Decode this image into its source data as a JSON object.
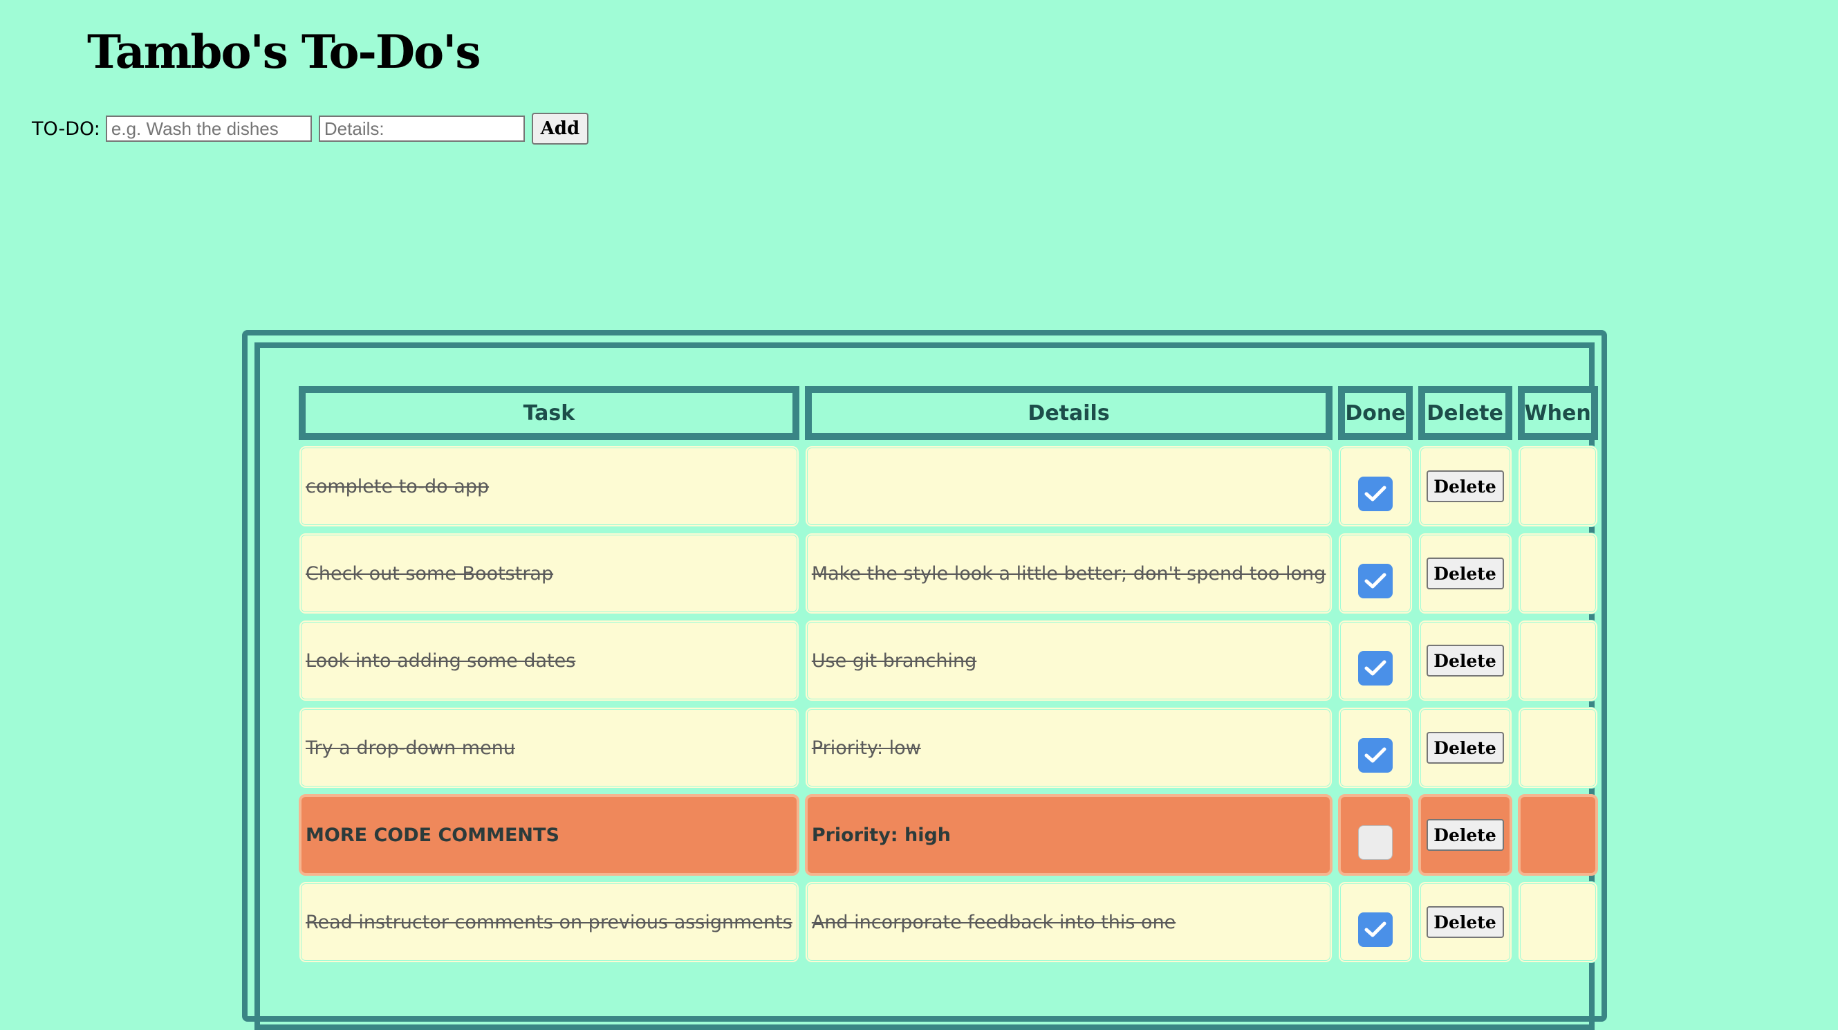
{
  "app": {
    "title": "Tambo's To-Do's"
  },
  "form": {
    "label": "TO-DO:",
    "task_placeholder": "e.g. Wash the dishes",
    "details_placeholder": "Details:",
    "add_label": "Add"
  },
  "table": {
    "headers": {
      "task": "Task",
      "details": "Details",
      "done": "Done",
      "delete": "Delete",
      "when": "When"
    },
    "rows": [
      {
        "task": "complete to-do app",
        "details": "",
        "done": true,
        "delete_label": "Delete",
        "when": ""
      },
      {
        "task": "Check out some Bootstrap",
        "details": "Make the style look a little better; don't spend too long",
        "done": true,
        "delete_label": "Delete",
        "when": ""
      },
      {
        "task": "Look into adding some dates",
        "details": "Use git branching",
        "done": true,
        "delete_label": "Delete",
        "when": ""
      },
      {
        "task": "Try a drop-down menu",
        "details": "Priority: low",
        "done": true,
        "delete_label": "Delete",
        "when": ""
      },
      {
        "task": "MORE CODE COMMENTS",
        "details": "Priority: high",
        "done": false,
        "delete_label": "Delete",
        "when": ""
      },
      {
        "task": "Read instructor comments on previous assignments",
        "details": "And incorporate feedback into this one",
        "done": true,
        "delete_label": "Delete",
        "when": ""
      }
    ]
  },
  "colors": {
    "background": "#a0fcd6",
    "frame": "#3a8585",
    "row": "#fdfbd3",
    "priority_row": "#ef885b",
    "checkbox": "#4a90e8"
  }
}
